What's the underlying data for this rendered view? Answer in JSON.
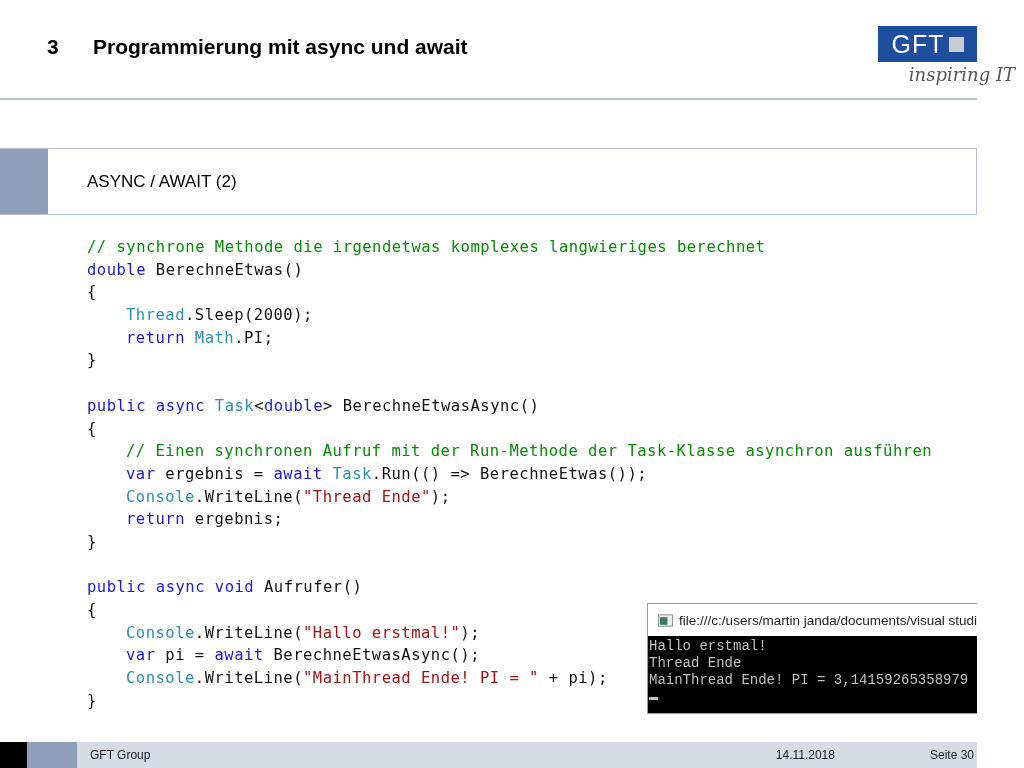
{
  "header": {
    "number": "3",
    "title": "Programmierung mit async und await",
    "logo": {
      "text": "GFT",
      "tagline": "inspiring IT"
    }
  },
  "section": {
    "title": "ASYNC / AWAIT (2)"
  },
  "code": {
    "blocks": [
      [
        {
          "tokens": [
            {
              "kind": "comment",
              "text": "// synchrone Methode die irgendetwas komplexes langwieriges berechnet"
            }
          ]
        },
        {
          "tokens": [
            {
              "kind": "keyword",
              "text": "double"
            },
            {
              "kind": "plain",
              "text": " BerechneEtwas()"
            }
          ]
        },
        {
          "tokens": [
            {
              "kind": "plain",
              "text": "{"
            }
          ],
          "children": [
            {
              "tokens": [
                {
                  "kind": "type",
                  "text": "Thread"
                },
                {
                  "kind": "plain",
                  "text": ".Sleep(2000);"
                }
              ]
            },
            {
              "tokens": [
                {
                  "kind": "keyword",
                  "text": "return"
                },
                {
                  "kind": "type",
                  "text": " Math"
                },
                {
                  "kind": "plain",
                  "text": ".PI;"
                }
              ]
            }
          ]
        },
        {
          "tokens": [
            {
              "kind": "plain",
              "text": "}"
            }
          ]
        }
      ],
      [
        {
          "tokens": [
            {
              "kind": "keyword",
              "text": "public async"
            },
            {
              "kind": "type",
              "text": " Task"
            },
            {
              "kind": "plain",
              "text": "<"
            },
            {
              "kind": "keyword",
              "text": "double"
            },
            {
              "kind": "plain",
              "text": "> BerechneEtwasAsync()"
            }
          ]
        },
        {
          "tokens": [
            {
              "kind": "plain",
              "text": "{"
            }
          ],
          "children": [
            {
              "tokens": [
                {
                  "kind": "comment",
                  "text": "// Einen synchronen Aufruf mit der Run-Methode der Task-Klasse asynchron ausführen"
                }
              ]
            },
            {
              "tokens": [
                {
                  "kind": "keyword",
                  "text": "var"
                },
                {
                  "kind": "plain",
                  "text": " ergebnis = "
                },
                {
                  "kind": "keyword",
                  "text": "await"
                },
                {
                  "kind": "type",
                  "text": " Task"
                },
                {
                  "kind": "plain",
                  "text": ".Run(() => BerechneEtwas());"
                }
              ]
            },
            {
              "tokens": [
                {
                  "kind": "type",
                  "text": "Console"
                },
                {
                  "kind": "plain",
                  "text": ".WriteLine("
                },
                {
                  "kind": "string",
                  "text": "\"Thread Ende\""
                },
                {
                  "kind": "plain",
                  "text": ");"
                }
              ]
            },
            {
              "tokens": [
                {
                  "kind": "keyword",
                  "text": "return"
                },
                {
                  "kind": "plain",
                  "text": " ergebnis;"
                }
              ]
            }
          ]
        },
        {
          "tokens": [
            {
              "kind": "plain",
              "text": "}"
            }
          ]
        }
      ],
      [
        {
          "tokens": [
            {
              "kind": "keyword",
              "text": "public async void"
            },
            {
              "kind": "plain",
              "text": " Aufrufer()"
            }
          ]
        },
        {
          "tokens": [
            {
              "kind": "plain",
              "text": "{"
            }
          ],
          "children": [
            {
              "tokens": [
                {
                  "kind": "type",
                  "text": "Console"
                },
                {
                  "kind": "plain",
                  "text": ".WriteLine("
                },
                {
                  "kind": "string",
                  "text": "\"Hallo erstmal!\""
                },
                {
                  "kind": "plain",
                  "text": ");"
                }
              ]
            },
            {
              "tokens": [
                {
                  "kind": "keyword",
                  "text": "var"
                },
                {
                  "kind": "plain",
                  "text": " pi = "
                },
                {
                  "kind": "keyword",
                  "text": "await"
                },
                {
                  "kind": "plain",
                  "text": " BerechneEtwasAsync();"
                }
              ]
            },
            {
              "tokens": [
                {
                  "kind": "type",
                  "text": "Console"
                },
                {
                  "kind": "plain",
                  "text": ".WriteLine("
                },
                {
                  "kind": "string",
                  "text": "\"MainThread Ende! PI = \""
                },
                {
                  "kind": "plain",
                  "text": " + pi);"
                }
              ]
            }
          ]
        },
        {
          "tokens": [
            {
              "kind": "plain",
              "text": "}"
            }
          ]
        }
      ]
    ]
  },
  "console": {
    "title": "file:///c:/users/martin janda/documents/visual studi",
    "lines": [
      "Hallo erstmal!",
      "Thread Ende",
      "MainThread Ende! PI = 3,14159265358979"
    ]
  },
  "footer": {
    "company": "GFT Group",
    "date": "14.11.2018",
    "page": "Seite 30"
  }
}
